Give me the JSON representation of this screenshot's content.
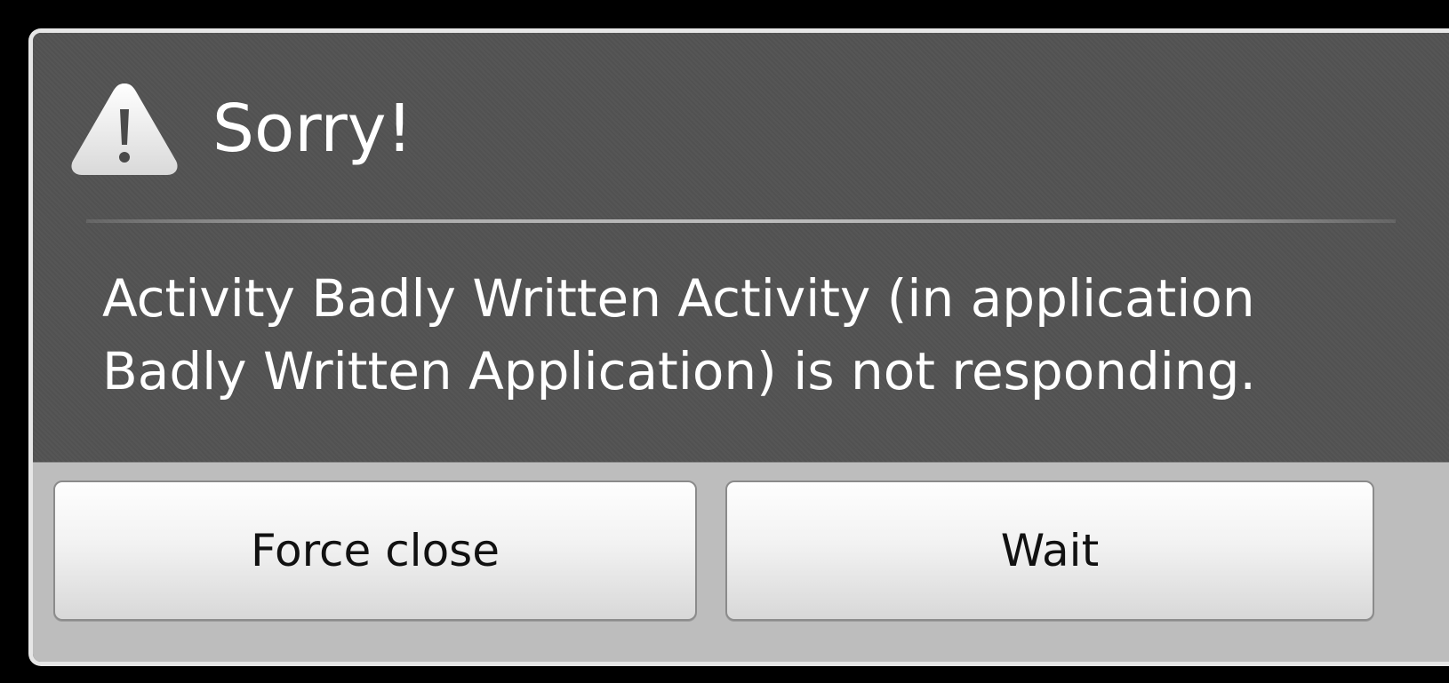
{
  "dialog": {
    "title": "Sorry!",
    "icon": "warning-icon",
    "message": "Activity Badly Written Activity (in application\nBadly Written Application) is not responding.",
    "buttons": {
      "force_close_label": "Force close",
      "wait_label": "Wait"
    }
  },
  "colors": {
    "dialog_background": "#535353",
    "button_bar_background": "#bdbdbd",
    "title_text": "#ffffff",
    "button_text": "#111111"
  }
}
